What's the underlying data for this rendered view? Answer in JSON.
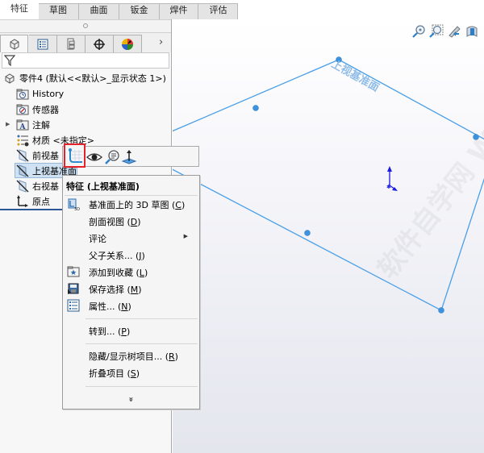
{
  "tabs": [
    {
      "label": "特征",
      "active": true
    },
    {
      "label": "草图"
    },
    {
      "label": "曲面"
    },
    {
      "label": "钣金"
    },
    {
      "label": "焊件"
    },
    {
      "label": "评估"
    }
  ],
  "manager_tabs": [
    {
      "icon": "feature-manager-icon"
    },
    {
      "icon": "property-manager-icon"
    },
    {
      "icon": "configuration-manager-icon"
    },
    {
      "icon": "dimxpert-manager-icon"
    },
    {
      "icon": "display-manager-icon"
    }
  ],
  "manager_more": "›",
  "tree": {
    "root": "零件4  (默认<<默认>_显示状态 1>)",
    "items": [
      {
        "label": "History",
        "icon": "history-folder-icon"
      },
      {
        "label": "传感器",
        "icon": "sensor-folder-icon"
      },
      {
        "label": "注解",
        "icon": "annotations-folder-icon",
        "expandable": true
      },
      {
        "label": "材质 <未指定>",
        "icon": "material-icon"
      },
      {
        "label": "前视基",
        "icon": "plane-icon"
      },
      {
        "label": "上视基准面",
        "icon": "plane-icon",
        "selected": true
      },
      {
        "label": "右视基",
        "icon": "plane-icon"
      },
      {
        "label": "原点",
        "icon": "origin-icon"
      }
    ]
  },
  "context_toolbar": [
    {
      "name": "sketch-button",
      "icon": "sketch-icon",
      "highlighted": true
    },
    {
      "name": "show-hide-button",
      "icon": "eye-icon"
    },
    {
      "name": "zoom-to-selection-button",
      "icon": "zoom-selection-icon"
    },
    {
      "name": "normal-to-button",
      "icon": "normal-to-icon"
    }
  ],
  "context_menu": {
    "title": "特征 (上视基准面)",
    "items": [
      {
        "label": "基准面上的 3D 草图",
        "key": "C",
        "icon": "3d-sketch-icon"
      },
      {
        "label": "剖面视图",
        "key": "D"
      },
      {
        "label": "评论",
        "submenu": true
      },
      {
        "label": "父子关系...",
        "key": "J"
      },
      {
        "label": "添加到收藏",
        "key": "L",
        "icon": "favorite-icon"
      },
      {
        "label": "保存选择",
        "key": "M",
        "icon": "save-selection-icon"
      },
      {
        "label": "属性...",
        "key": "N",
        "icon": "properties-icon"
      },
      {
        "label": "转到...",
        "key": "P"
      },
      {
        "label": "隐藏/显示树项目...",
        "key": "R"
      },
      {
        "label": "折叠项目",
        "key": "S"
      }
    ],
    "more": "»"
  },
  "viewport": {
    "plane_label": "上视基准面",
    "plane_color": "#4a9fe8",
    "triad_color": "#1a1ae6",
    "toolbar": [
      {
        "name": "zoom-to-fit-button",
        "icon": "zoom-fit-icon"
      },
      {
        "name": "zoom-to-area-button",
        "icon": "zoom-area-icon"
      },
      {
        "name": "previous-view-button",
        "icon": "previous-view-icon"
      },
      {
        "name": "section-view-button",
        "icon": "section-view-icon"
      }
    ]
  },
  "watermark": "软件自学网  WWW.RJZXW.COM",
  "colors": {
    "selection_bg": "#cfe2f3",
    "highlight_border": "#e5212b",
    "panel_divider": "#2b5797"
  }
}
